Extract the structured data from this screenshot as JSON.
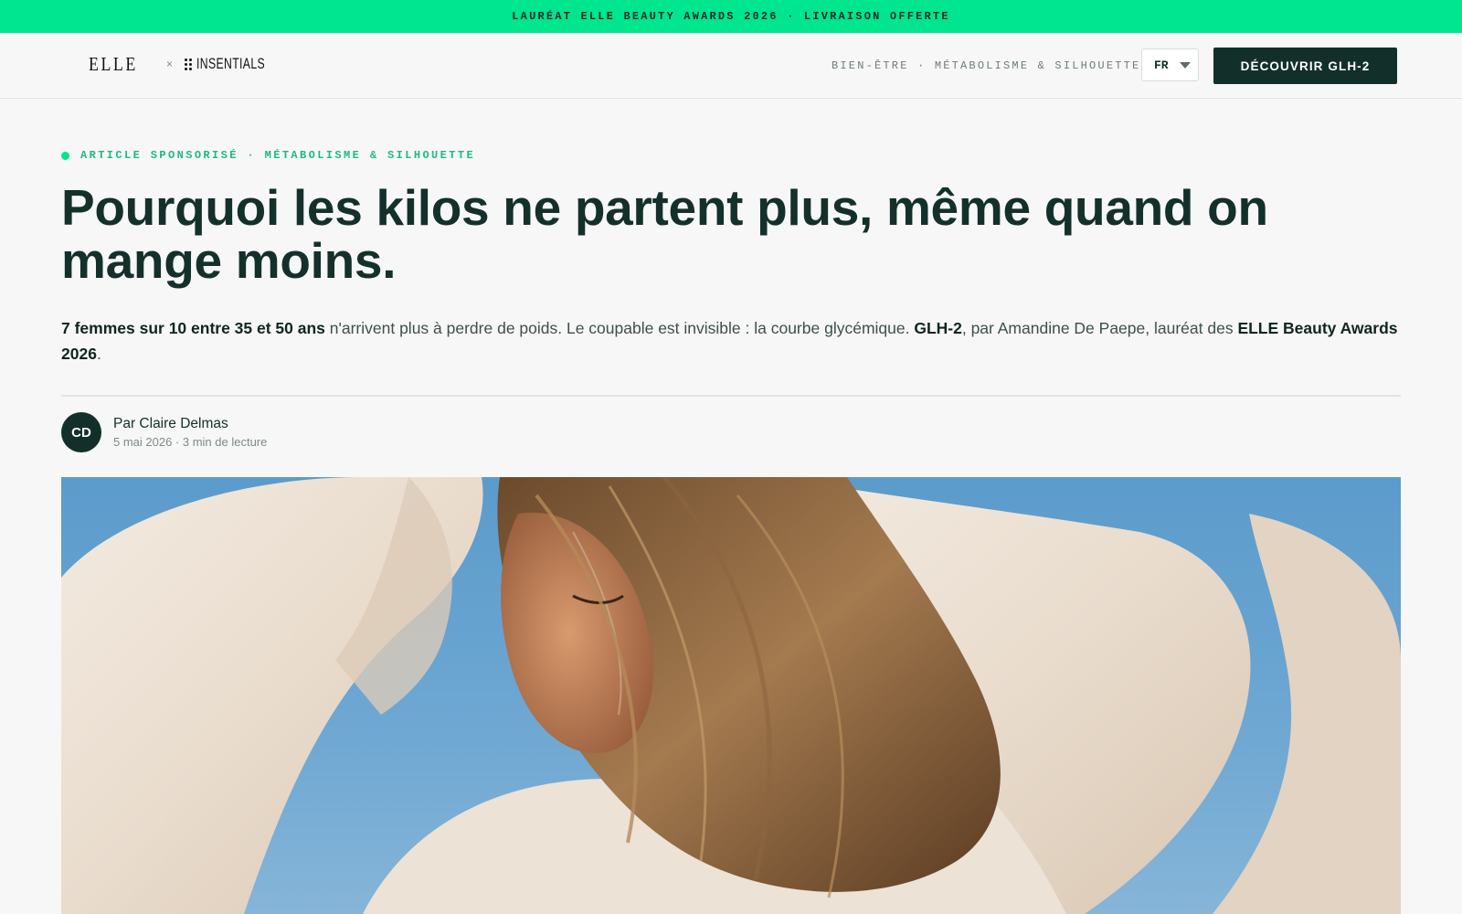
{
  "announcement": {
    "text": "LAURÉAT ELLE BEAUTY AWARDS 2026 · LIVRAISON OFFERTE"
  },
  "header": {
    "logo_elle": "ELLE",
    "logo_separator": "×",
    "logo_insentials": "INSENTIALS",
    "nav_text": "BIEN-ÊTRE · MÉTABOLISME & SILHOUETTE",
    "language": {
      "selected": "FR",
      "icon": "chevron-down-icon"
    },
    "cta_label": "DÉCOUVRIR GLH-2"
  },
  "article": {
    "kicker": "ARTICLE SPONSORISÉ · MÉTABOLISME & SILHOUETTE",
    "title": "Pourquoi les kilos ne partent plus, même quand on mange moins.",
    "lede": {
      "bold_1": "7 femmes sur 10 entre 35 et 50 ans",
      "text_1": " n'arrivent plus à perdre de poids. Le coupable est invisible : la courbe glycémique. ",
      "bold_2": "GLH-2",
      "text_2": ", par Amandine De Paepe, lauréat des ",
      "bold_3": "ELLE Beauty Awards 2026",
      "text_3": "."
    },
    "author": {
      "initials": "CD",
      "byline": "Par Claire Delmas",
      "meta": "5 mai 2026 · 3 min de lecture"
    }
  },
  "colors": {
    "accent_green": "#00e58f",
    "dark_green": "#123029",
    "sky_blue": "#6fa8d3"
  }
}
